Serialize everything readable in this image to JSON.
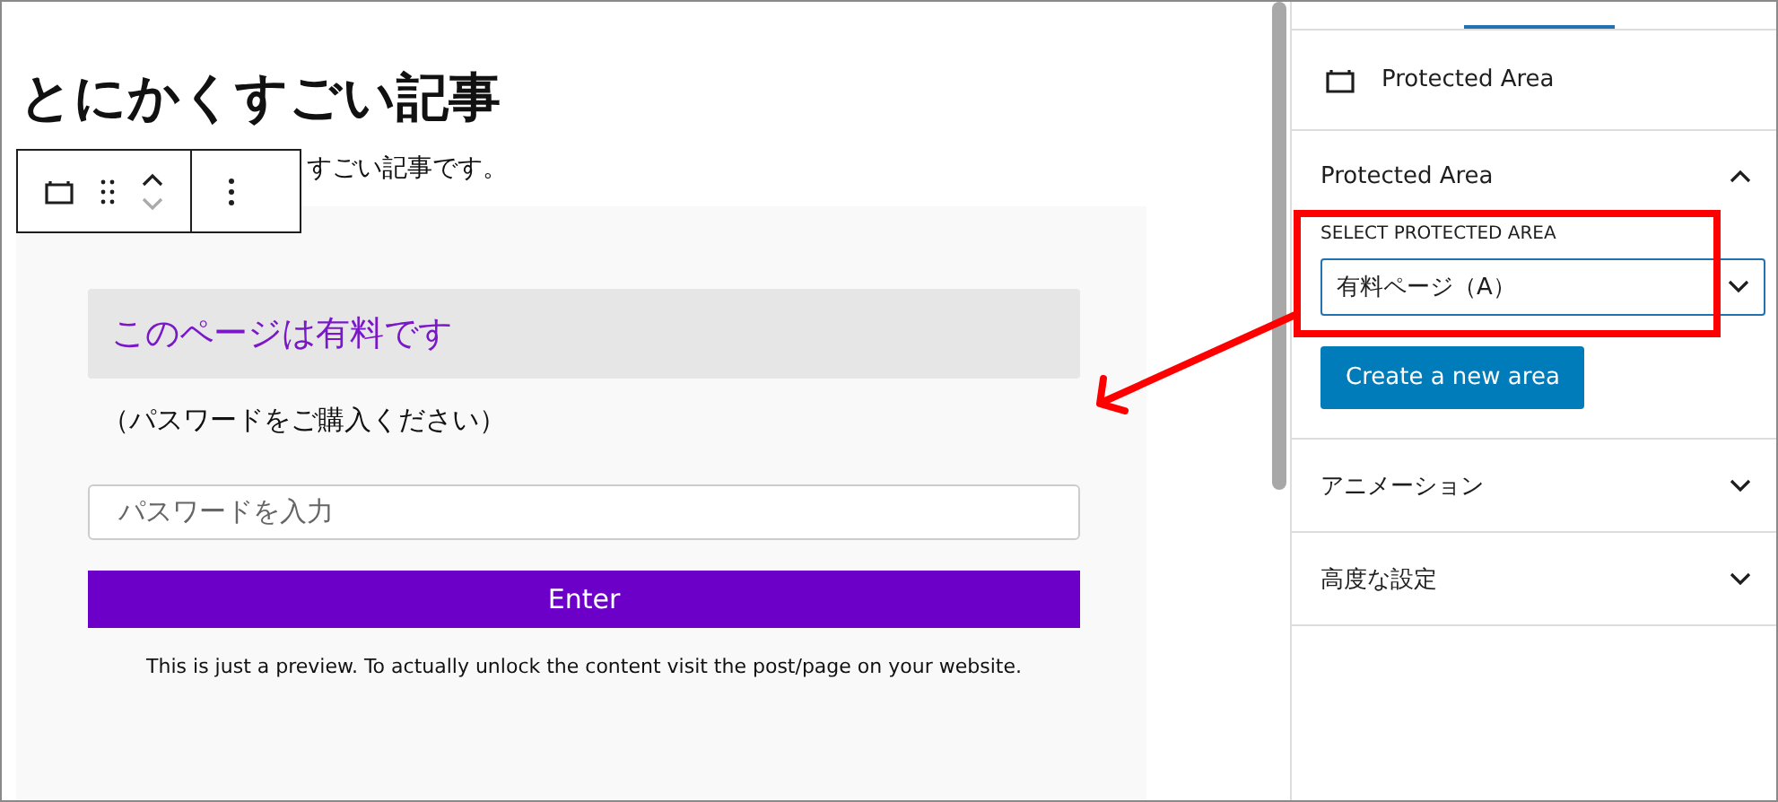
{
  "post": {
    "title": "とにかくすごい記事",
    "paragraph": "すごい記事です。"
  },
  "preview": {
    "heading": "このページは有料です",
    "subtitle": "（パスワードをご購入ください）",
    "password_field": {
      "placeholder": "パスワードを入力"
    },
    "enter_button": "Enter",
    "note": "This is just a preview. To actually unlock the content visit the post/page on your website."
  },
  "sidebar": {
    "block_card": {
      "title": "Protected Area"
    },
    "panels": [
      {
        "title": "Protected Area",
        "expanded": true,
        "select_label": "SELECT PROTECTED AREA",
        "select_value": "有料ページ（A）",
        "button": "Create a new area"
      },
      {
        "title": "アニメーション",
        "expanded": false
      },
      {
        "title": "高度な設定",
        "expanded": false
      }
    ]
  }
}
